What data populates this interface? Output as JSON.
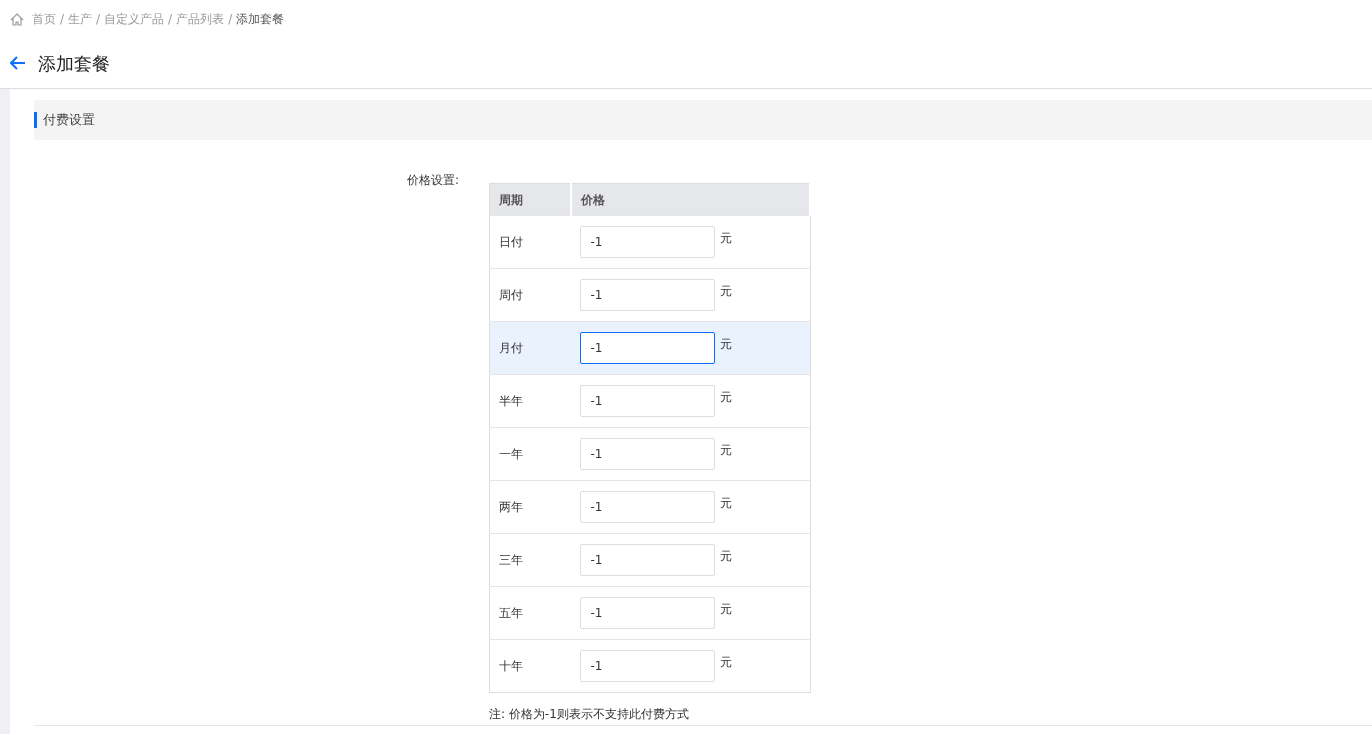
{
  "breadcrumb": [
    {
      "label": "首页"
    },
    {
      "separator": "/",
      "label": "生产"
    },
    {
      "separator": "/",
      "label": "自定义产品"
    },
    {
      "separator": "/",
      "label": "产品列表"
    },
    {
      "separator": "/",
      "label": "添加套餐"
    }
  ],
  "page_title": "添加套餐",
  "section_title": "付费设置",
  "price_label": "价格设置:",
  "table": {
    "columns": [
      "周期",
      "价格"
    ],
    "rows": [
      {
        "period": "日付",
        "value": "-1",
        "unit": "元",
        "focused": false
      },
      {
        "period": "周付",
        "value": "-1",
        "unit": "元",
        "focused": false
      },
      {
        "period": "月付",
        "value": "-1",
        "unit": "元",
        "focused": true
      },
      {
        "period": "半年",
        "value": "-1",
        "unit": "元",
        "focused": false
      },
      {
        "period": "一年",
        "value": "-1",
        "unit": "元",
        "focused": false
      },
      {
        "period": "两年",
        "value": "-1",
        "unit": "元",
        "focused": false
      },
      {
        "period": "三年",
        "value": "-1",
        "unit": "元",
        "focused": false
      },
      {
        "period": "五年",
        "value": "-1",
        "unit": "元",
        "focused": false
      },
      {
        "period": "十年",
        "value": "-1",
        "unit": "元",
        "focused": false
      }
    ]
  },
  "note": "注: 价格为-1则表示不支持此付费方式"
}
